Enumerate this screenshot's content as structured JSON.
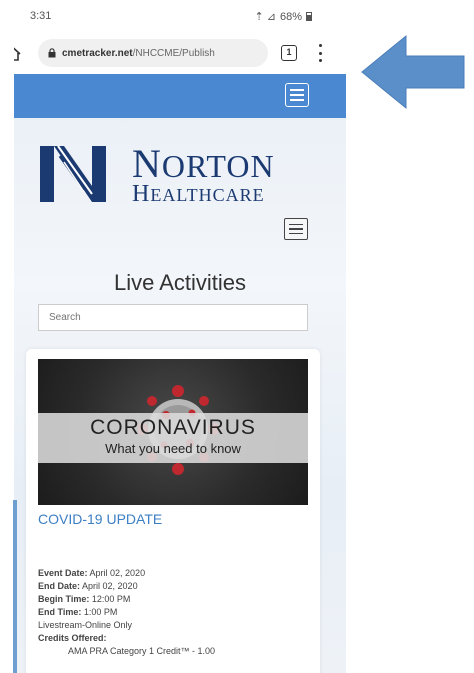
{
  "status_bar": {
    "time": "3:31",
    "signal_text": "⇡ ⊿",
    "battery_percent": "68%"
  },
  "browser": {
    "url_domain": "cmetracker.net",
    "url_path": "/NHCCME/Publish",
    "tab_count": "1"
  },
  "logo": {
    "line1_first": "N",
    "line1_rest": "ORTON",
    "line2_first": "H",
    "line2_rest": "EALTHCARE"
  },
  "page": {
    "title": "Live Activities",
    "search_placeholder": "Search"
  },
  "activity": {
    "image_title": "CORONAVIRUS",
    "image_subtitle": "What you need to know",
    "link_text": "COVID-19 UPDATE",
    "event_date_label": "Event Date:",
    "event_date": "April 02, 2020",
    "end_date_label": "End Date:",
    "end_date": "April 02, 2020",
    "begin_time_label": "Begin Time:",
    "begin_time": "12:00 PM",
    "end_time_label": "End Time:",
    "end_time": "1:00 PM",
    "format": "Livestream-Online Only",
    "credits_label": "Credits Offered:",
    "credit_line": "AMA PRA Category 1 Credit™ - 1.00"
  },
  "colors": {
    "nav_blue": "#4a89d2",
    "link_blue": "#3c7fc4",
    "logo_navy": "#1b3a72",
    "arrow_blue": "#5b8fc9"
  }
}
